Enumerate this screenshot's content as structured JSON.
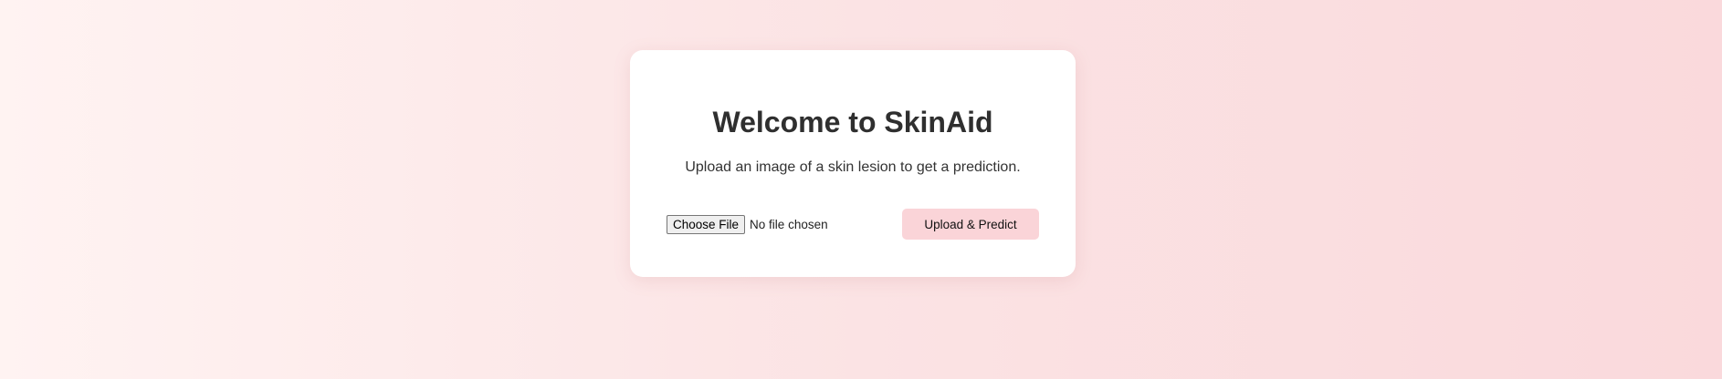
{
  "card": {
    "title": "Welcome to SkinAid",
    "subtitle": "Upload an image of a skin lesion to get a prediction."
  },
  "upload": {
    "choose_label": "Choose File",
    "file_status": "No file chosen",
    "submit_label": "Upload & Predict"
  },
  "colors": {
    "background_left": "#fff3f2",
    "background_right": "#fad9dc",
    "card": "#ffffff",
    "button": "#fad4d8",
    "text": "#333333"
  }
}
